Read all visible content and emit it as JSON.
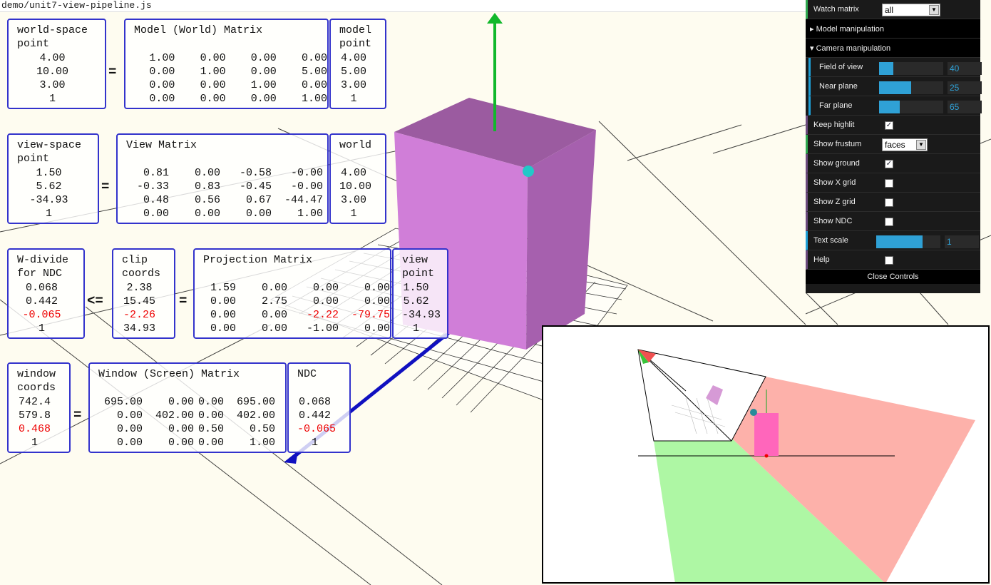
{
  "file_bar": {
    "path": "demo/unit7-view-pipeline.js"
  },
  "matrices": {
    "world_point": {
      "title": [
        "world-space",
        "point"
      ],
      "rows": [
        "4.00",
        "10.00",
        "3.00",
        "1"
      ]
    },
    "model_matrix": {
      "title": "Model (World) Matrix",
      "rows": [
        [
          "1.00",
          "0.00",
          "0.00",
          "0.00"
        ],
        [
          "0.00",
          "1.00",
          "0.00",
          "5.00"
        ],
        [
          "0.00",
          "0.00",
          "1.00",
          "0.00"
        ],
        [
          "0.00",
          "0.00",
          "0.00",
          "1.00"
        ]
      ]
    },
    "model_point": {
      "title": [
        "model",
        "point"
      ],
      "rows": [
        "4.00",
        "5.00",
        "3.00",
        "1"
      ]
    },
    "view_point": {
      "title": [
        "view-space",
        "point"
      ],
      "rows": [
        "1.50",
        "5.62",
        "-34.93",
        "1"
      ]
    },
    "view_matrix": {
      "title": "View Matrix",
      "rows": [
        [
          "0.81",
          "0.00",
          "-0.58",
          "-0.00"
        ],
        [
          "-0.33",
          "0.83",
          "-0.45",
          "-0.00"
        ],
        [
          "0.48",
          "0.56",
          "0.67",
          "-44.47"
        ],
        [
          "0.00",
          "0.00",
          "0.00",
          "1.00"
        ]
      ]
    },
    "world_col": {
      "title": [
        "world"
      ],
      "rows": [
        "4.00",
        "10.00",
        "3.00",
        "1"
      ]
    },
    "ndc_divide": {
      "title": [
        "W-divide",
        "for NDC"
      ],
      "rows": [
        "0.068",
        "0.442",
        "-0.065",
        "1"
      ]
    },
    "clip_coords": {
      "title": [
        "clip",
        "coords"
      ],
      "rows": [
        "2.38",
        "15.45",
        "-2.26",
        "34.93"
      ]
    },
    "proj_matrix": {
      "title": "Projection Matrix",
      "rows": [
        [
          "1.59",
          "0.00",
          "0.00",
          "0.00"
        ],
        [
          "0.00",
          "2.75",
          "0.00",
          "0.00"
        ],
        [
          "0.00",
          "0.00",
          "-2.22",
          "-79.75"
        ],
        [
          "0.00",
          "0.00",
          "-1.00",
          "0.00"
        ]
      ]
    },
    "view_col": {
      "title": [
        "view",
        "point"
      ],
      "rows": [
        "1.50",
        "5.62",
        "-34.93",
        "1"
      ]
    },
    "window_coords": {
      "title": [
        "window",
        "coords"
      ],
      "rows": [
        "742.4",
        "579.8",
        "0.468",
        "1"
      ]
    },
    "window_matrix": {
      "title": "Window (Screen) Matrix",
      "rows": [
        [
          "695.00",
          "0.00",
          "0.00",
          "695.00"
        ],
        [
          "0.00",
          "402.00",
          "0.00",
          "402.00"
        ],
        [
          "0.00",
          "0.00",
          "0.50",
          "0.50"
        ],
        [
          "0.00",
          "0.00",
          "0.00",
          "1.00"
        ]
      ]
    },
    "ndc_col": {
      "title": [
        "NDC"
      ],
      "rows": [
        "0.068",
        "0.442",
        "-0.065",
        "1"
      ]
    }
  },
  "operators": {
    "equals": "=",
    "le": "<="
  },
  "controls": {
    "watch_matrix": {
      "label": "Watch matrix",
      "value": "all"
    },
    "model_folder": "Model manipulation",
    "camera_folder": "Camera manipulation",
    "fov": {
      "label": "Field of view",
      "value": "40",
      "fill": 0.22
    },
    "near": {
      "label": "Near plane",
      "value": "25",
      "fill": 0.5
    },
    "far": {
      "label": "Far plane",
      "value": "65",
      "fill": 0.32
    },
    "keep_highlit": {
      "label": "Keep highlit",
      "checked": true
    },
    "show_frustum": {
      "label": "Show frustum",
      "value": "faces"
    },
    "show_ground": {
      "label": "Show ground",
      "checked": true
    },
    "show_x_grid": {
      "label": "Show X grid",
      "checked": false
    },
    "show_z_grid": {
      "label": "Show Z grid",
      "checked": false
    },
    "show_ndc": {
      "label": "Show NDC",
      "checked": false
    },
    "text_scale": {
      "label": "Text scale",
      "value": "1",
      "fill": 0.72
    },
    "help": {
      "label": "Help",
      "checked": false
    },
    "close": "Close Controls"
  },
  "colors": {
    "box_border": "#3333cc",
    "negative": "#ee0000",
    "cube": "#cc80d8",
    "accent": "#2fa1d6"
  }
}
